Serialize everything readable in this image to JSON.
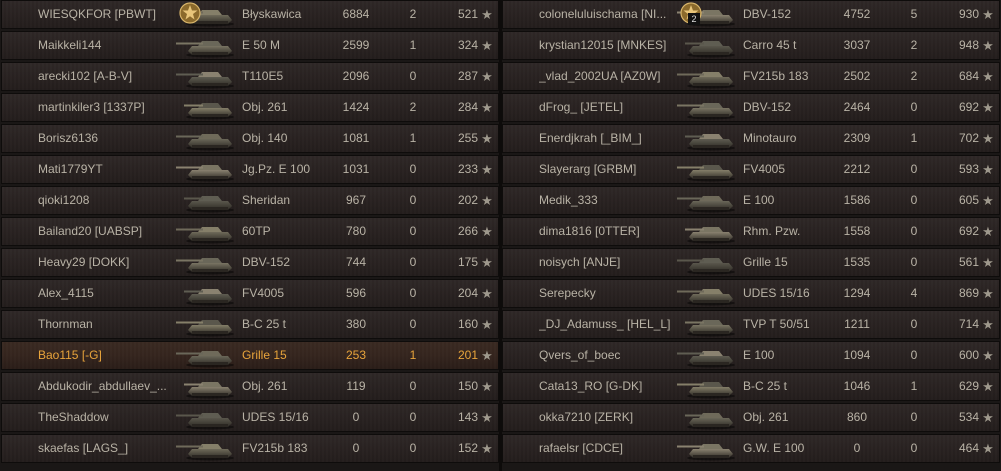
{
  "left_team": [
    {
      "player": "WIESQKFOR [PBWT]",
      "vehicle": "Błyskawica",
      "damage": "6884",
      "kills": "2",
      "xp": "521",
      "medal": true
    },
    {
      "player": "Maikkeli144",
      "vehicle": "E 50 M",
      "damage": "2599",
      "kills": "1",
      "xp": "324"
    },
    {
      "player": "arecki102 [A-B-V]",
      "vehicle": "T110E5",
      "damage": "2096",
      "kills": "0",
      "xp": "287"
    },
    {
      "player": "martinkiler3 [1337P]",
      "vehicle": "Obj. 261",
      "damage": "1424",
      "kills": "2",
      "xp": "284"
    },
    {
      "player": "Borisz6136",
      "vehicle": "Obj. 140",
      "damage": "1081",
      "kills": "1",
      "xp": "255"
    },
    {
      "player": "Mati1779YT",
      "vehicle": "Jg.Pz. E 100",
      "damage": "1031",
      "kills": "0",
      "xp": "233"
    },
    {
      "player": "qioki1208",
      "vehicle": "Sheridan",
      "damage": "967",
      "kills": "0",
      "xp": "202"
    },
    {
      "player": "Bailand20 [UABSP]",
      "vehicle": "60TP",
      "damage": "780",
      "kills": "0",
      "xp": "266"
    },
    {
      "player": "Heavy29 [DOKK]",
      "vehicle": "DBV-152",
      "damage": "744",
      "kills": "0",
      "xp": "175"
    },
    {
      "player": "Alex_4115",
      "vehicle": "FV4005",
      "damage": "596",
      "kills": "0",
      "xp": "204"
    },
    {
      "player": "Thornman",
      "vehicle": "B-C 25 t",
      "damage": "380",
      "kills": "0",
      "xp": "160"
    },
    {
      "player": "Bao115 [-G]",
      "vehicle": "Grille 15",
      "damage": "253",
      "kills": "1",
      "xp": "201",
      "self": true
    },
    {
      "player": "Abdukodir_abdullaev_...",
      "vehicle": "Obj. 261",
      "damage": "119",
      "kills": "0",
      "xp": "150"
    },
    {
      "player": "TheShaddow",
      "vehicle": "UDES 15/16",
      "damage": "0",
      "kills": "0",
      "xp": "143"
    },
    {
      "player": "skaefas [LAGS_]",
      "vehicle": "FV215b 183",
      "damage": "0",
      "kills": "0",
      "xp": "152"
    }
  ],
  "right_team": [
    {
      "player": "coloneluluischama [NI...",
      "vehicle": "DBV-152",
      "damage": "4752",
      "kills": "5",
      "xp": "930",
      "medal": true,
      "medal_badge": "2"
    },
    {
      "player": "krystian12015 [MNKES]",
      "vehicle": "Carro 45 t",
      "damage": "3037",
      "kills": "2",
      "xp": "948"
    },
    {
      "player": "_vlad_2002UA [AZ0W]",
      "vehicle": "FV215b 183",
      "damage": "2502",
      "kills": "2",
      "xp": "684"
    },
    {
      "player": "dFrog_ [JETEL]",
      "vehicle": "DBV-152",
      "damage": "2464",
      "kills": "0",
      "xp": "692"
    },
    {
      "player": "Enerdjkrah [_BIM_]",
      "vehicle": "Minotauro",
      "damage": "2309",
      "kills": "1",
      "xp": "702"
    },
    {
      "player": "Slayerarg [GRBM]",
      "vehicle": "FV4005",
      "damage": "2212",
      "kills": "0",
      "xp": "593"
    },
    {
      "player": "Medik_333",
      "vehicle": "E 100",
      "damage": "1586",
      "kills": "0",
      "xp": "605"
    },
    {
      "player": "dima1816 [0TTER]",
      "vehicle": "Rhm. Pzw.",
      "damage": "1558",
      "kills": "0",
      "xp": "692"
    },
    {
      "player": "noisych [ANJE]",
      "vehicle": "Grille 15",
      "damage": "1535",
      "kills": "0",
      "xp": "561"
    },
    {
      "player": "Serepecky",
      "vehicle": "UDES 15/16",
      "damage": "1294",
      "kills": "4",
      "xp": "869"
    },
    {
      "player": "_DJ_Adamuss_ [HEL_L]",
      "vehicle": "TVP T 50/51",
      "damage": "1211",
      "kills": "0",
      "xp": "714"
    },
    {
      "player": "Qvers_of_boec",
      "vehicle": "E 100",
      "damage": "1094",
      "kills": "0",
      "xp": "600"
    },
    {
      "player": "Cata13_RO [G-DK]",
      "vehicle": "B-C 25 t",
      "damage": "1046",
      "kills": "1",
      "xp": "629"
    },
    {
      "player": "okka7210 [ZERK]",
      "vehicle": "Obj. 261",
      "damage": "860",
      "kills": "0",
      "xp": "534"
    },
    {
      "player": "rafaelsr [CDCE]",
      "vehicle": "G.W. E 100",
      "damage": "0",
      "kills": "0",
      "xp": "464"
    }
  ],
  "icons": {
    "xp_icon": "star-icon",
    "medal_icon": "medal-icon",
    "tank_icon": "tank-icon"
  },
  "colors": {
    "self_highlight": "#e8a43b",
    "text": "#b9b3a6"
  }
}
